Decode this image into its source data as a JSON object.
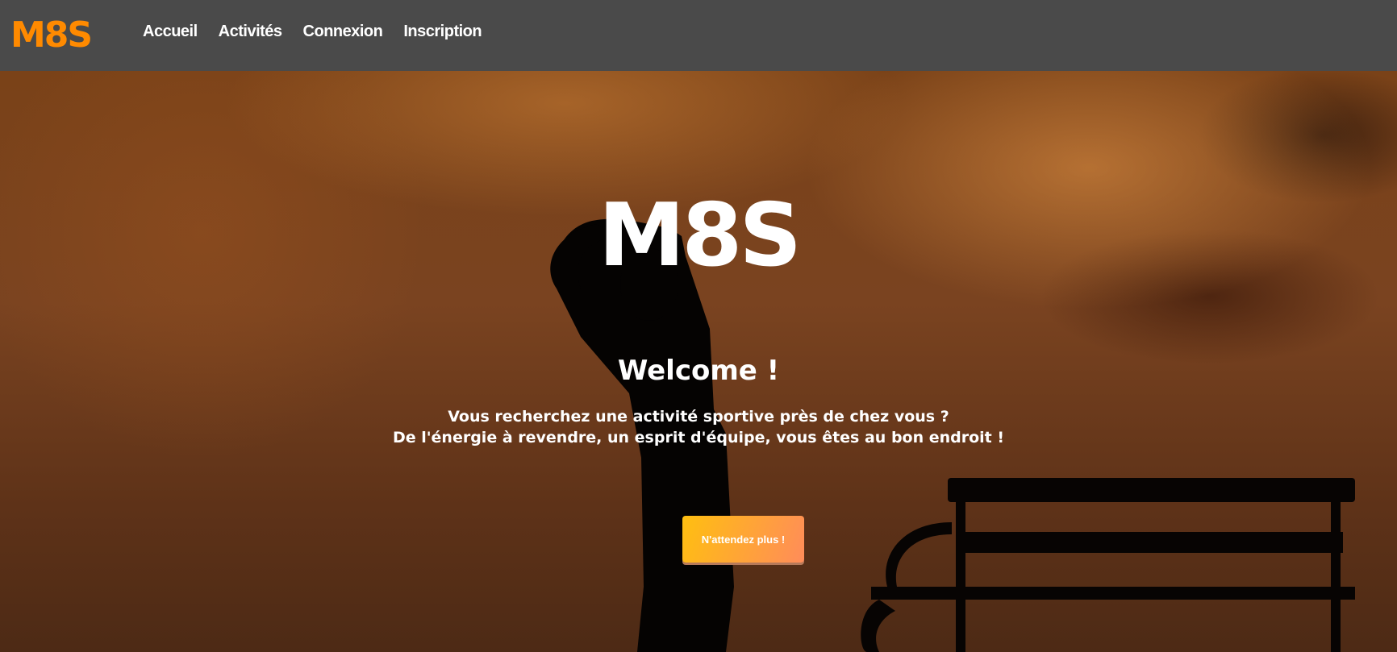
{
  "nav": {
    "logo": "M8S",
    "items": [
      {
        "label": "Accueil"
      },
      {
        "label": "Activités"
      },
      {
        "label": "Connexion"
      },
      {
        "label": "Inscription"
      }
    ]
  },
  "hero": {
    "logo": "M8S",
    "title": "Welcome !",
    "subtitle_line1": "Vous recherchez une activité sportive près de chez vous ?",
    "subtitle_line2": "De l'énergie à revendre, un esprit d'équipe, vous êtes au bon endroit !",
    "cta_label": "N'attendez plus !"
  },
  "colors": {
    "brand": "#ff8a00",
    "nav_bg": "#4a4a4a",
    "cta_start": "#ffbf10",
    "cta_end": "#ff8c5a"
  }
}
